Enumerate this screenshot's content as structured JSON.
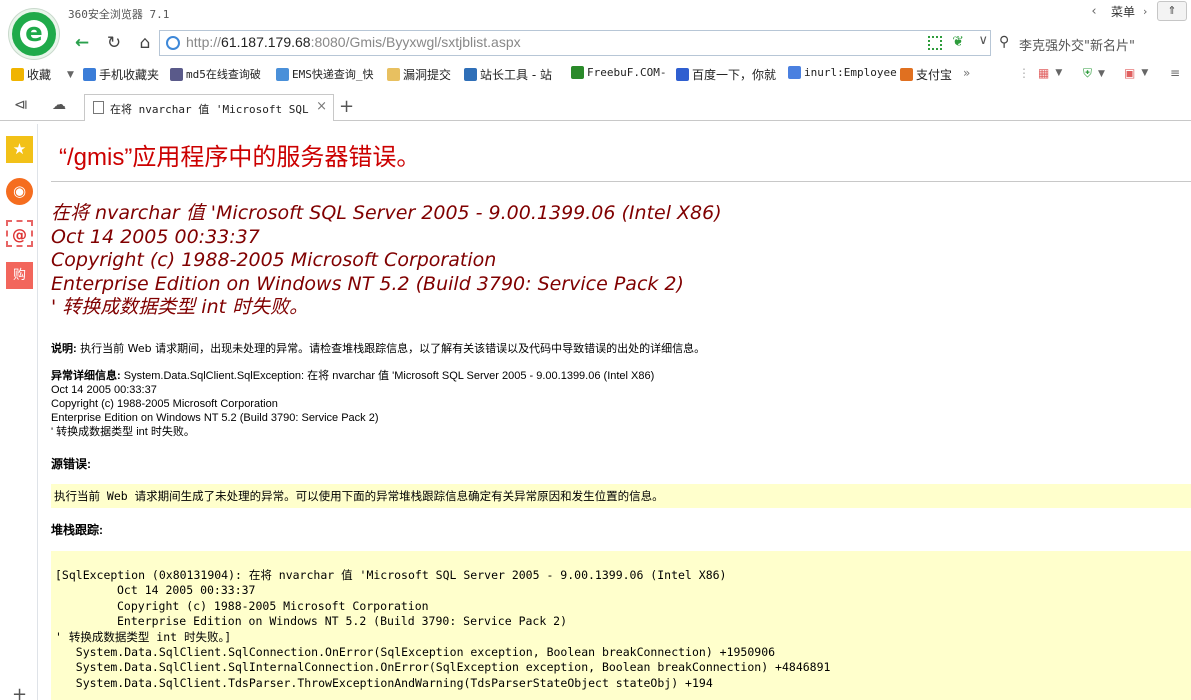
{
  "browser": {
    "app_title": "360安全浏览器 7.1",
    "menu_label": "菜单",
    "url_scheme": "http://",
    "url_host": "61.187.179.68",
    "url_rest": ":8080/Gmis/Byyxwgl/sxtjblist.aspx",
    "search_text": "李克强外交\"新名片\"",
    "tab_title": "在将 nvarchar 值 'Microsoft SQL Se"
  },
  "favorites": [
    {
      "label": "收藏",
      "color": "#f0b400"
    },
    {
      "label": "手机收藏夹",
      "color": "#3b7dd8"
    },
    {
      "label": "md5在线查询破",
      "color": "#5a5a8a"
    },
    {
      "label": "EMS快递查询_快",
      "color": "#4a90d9"
    },
    {
      "label": "漏洞提交",
      "color": "#e8c060"
    },
    {
      "label": "站长工具 - 站",
      "color": "#2f6fb8"
    },
    {
      "label": "FreebuF.COM-",
      "color": "#2a8a2a"
    },
    {
      "label": "百度一下，你就",
      "color": "#2f5fd0"
    },
    {
      "label": "inurl:Employee",
      "color": "#4a80e0"
    },
    {
      "label": "支付宝",
      "color": "#e07020"
    }
  ],
  "page": {
    "title": "“/gmis”应用程序中的服务器错误。",
    "error_lines": [
      "在将 nvarchar 值 'Microsoft SQL Server 2005 - 9.00.1399.06 (Intel X86)",
      "Oct 14 2005 00:33:37",
      "Copyright (c) 1988-2005 Microsoft Corporation",
      "Enterprise Edition on Windows NT 5.2 (Build 3790: Service Pack 2)",
      "' 转换成数据类型 int 时失败。"
    ],
    "desc_label": "说明:",
    "desc_text": " 执行当前 Web 请求期间，出现未处理的异常。请检查堆栈跟踪信息，以了解有关该错误以及代码中导致错误的出处的详细信息。",
    "exc_label": "异常详细信息:",
    "exc_lines": [
      " System.Data.SqlClient.SqlException: 在将 nvarchar 值 'Microsoft SQL Server 2005 - 9.00.1399.06 (Intel X86)",
      "Oct 14 2005 00:33:37",
      "Copyright (c) 1988-2005 Microsoft Corporation",
      "Enterprise Edition on Windows NT 5.2 (Build 3790: Service Pack 2)",
      "' 转换成数据类型 int 时失败。"
    ],
    "source_label": "源错误:",
    "source_text": "执行当前 Web 请求期间生成了未处理的异常。可以使用下面的异常堆栈跟踪信息确定有关异常原因和发生位置的信息。",
    "stack_label": "堆栈跟踪:",
    "stack_lines": [
      "[SqlException (0x80131904): 在将 nvarchar 值 'Microsoft SQL Server 2005 - 9.00.1399.06 (Intel X86)",
      "\tOct 14 2005 00:33:37",
      "\tCopyright (c) 1988-2005 Microsoft Corporation",
      "\tEnterprise Edition on Windows NT 5.2 (Build 3790: Service Pack 2)",
      "' 转换成数据类型 int 时失败。]",
      "   System.Data.SqlClient.SqlConnection.OnError(SqlException exception, Boolean breakConnection) +1950906",
      "   System.Data.SqlClient.SqlInternalConnection.OnError(SqlException exception, Boolean breakConnection) +4846891",
      "   System.Data.SqlClient.TdsParser.ThrowExceptionAndWarning(TdsParserStateObject stateObj) +194"
    ]
  }
}
